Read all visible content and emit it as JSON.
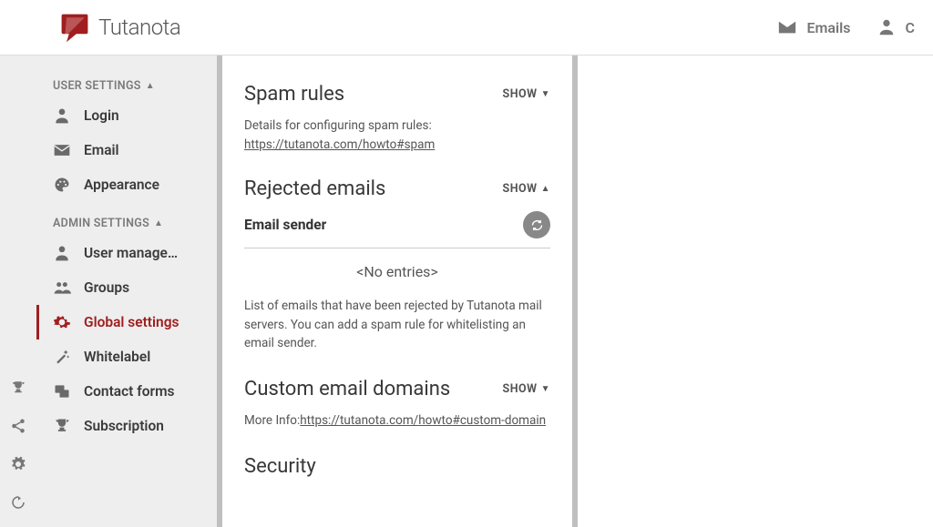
{
  "brand": {
    "name": "Tutanota"
  },
  "colors": {
    "accent": "#a01e20"
  },
  "header": {
    "nav": [
      {
        "label": "Emails",
        "icon": "mail-icon"
      },
      {
        "label": "C",
        "icon": "person-icon"
      }
    ]
  },
  "sidebar": {
    "sections": [
      {
        "heading": "USER SETTINGS",
        "expanded": true,
        "items": [
          {
            "label": "Login",
            "icon": "person-icon"
          },
          {
            "label": "Email",
            "icon": "mail-icon"
          },
          {
            "label": "Appearance",
            "icon": "palette-icon"
          }
        ]
      },
      {
        "heading": "ADMIN SETTINGS",
        "expanded": true,
        "items": [
          {
            "label": "User manage…",
            "icon": "person-icon"
          },
          {
            "label": "Groups",
            "icon": "group-icon"
          },
          {
            "label": "Global settings",
            "icon": "gear-icon",
            "active": true
          },
          {
            "label": "Whitelabel",
            "icon": "wand-icon"
          },
          {
            "label": "Contact forms",
            "icon": "forms-icon"
          },
          {
            "label": "Subscription",
            "icon": "trophy-icon"
          }
        ]
      }
    ]
  },
  "main": {
    "spam": {
      "title": "Spam rules",
      "toggle": "SHOW",
      "expanded": false,
      "desc": "Details for configuring spam rules:",
      "link": "https://tutanota.com/howto#spam"
    },
    "rejected": {
      "title": "Rejected emails",
      "toggle": "SHOW",
      "expanded": true,
      "subheader": "Email sender",
      "no_entries": "<No entries>",
      "help": "List of emails that have been rejected by Tutanota mail servers. You can add a spam rule for whitelisting an email sender."
    },
    "custom": {
      "title": "Custom email domains",
      "toggle": "SHOW",
      "expanded": false,
      "desc_prefix": "More Info:",
      "link": "https://tutanota.com/howto#custom-domain"
    },
    "security": {
      "title": "Security"
    }
  }
}
